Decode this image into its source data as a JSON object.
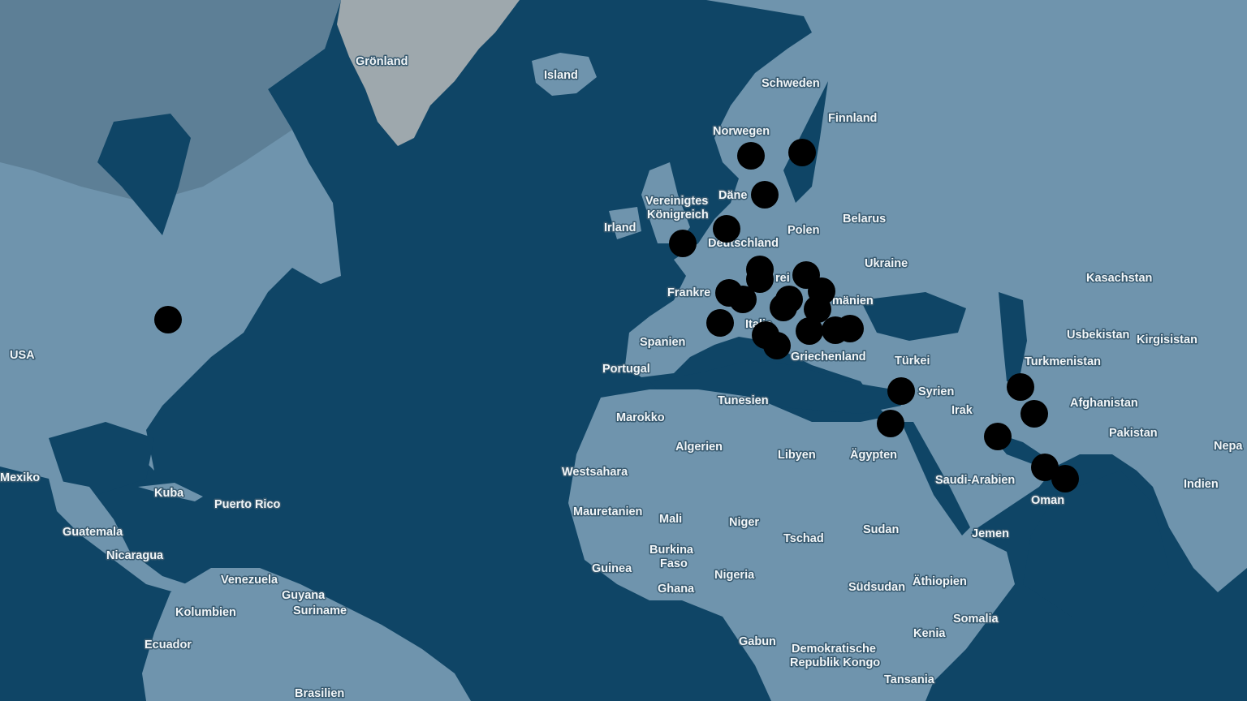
{
  "map": {
    "background_color": "#0f4566",
    "land_color": "#6f94ad",
    "land_shade_color": "#5d7f96",
    "greenland_color": "#9ea8ad",
    "marker_icon": "store-icon",
    "labels": {
      "groenland": "Grönland",
      "island": "Island",
      "schweden": "Schweden",
      "finnland": "Finnland",
      "norwegen": "Norwegen",
      "vereinigtes": "Vereinigtes",
      "koenigreich": "Königreich",
      "daenemark": "Däne",
      "irland": "Irland",
      "polen": "Polen",
      "belarus": "Belarus",
      "deutschland": "Deutschland",
      "ukraine": "Ukraine",
      "kasachstan": "Kasachstan",
      "frankreich": "Frankre",
      "oesterreich": "rei",
      "rumaenien": "mänien",
      "usbekistan": "Usbekistan",
      "kirgisistan": "Kirgisistan",
      "spanien": "Spanien",
      "italien": "Italie",
      "griechenland": "Griechenland",
      "tuerkei": "Türkei",
      "turkmenistan": "Turkmenistan",
      "usa": "USA",
      "portugal": "Portugal",
      "syrien": "Syrien",
      "irak": "Irak",
      "afghanistan": "Afghanistan",
      "tunesien": "Tunesien",
      "marokko": "Marokko",
      "pakistan": "Pakistan",
      "algerien": "Algerien",
      "libyen": "Libyen",
      "aegypten": "Ägypten",
      "nepal": "Nepa",
      "westsahara": "Westsahara",
      "mexiko": "Mexiko",
      "saudi_arabien": "Saudi-Arabien",
      "indien": "Indien",
      "kuba": "Kuba",
      "puerto_rico": "Puerto Rico",
      "oman": "Oman",
      "mauretanien": "Mauretanien",
      "mali": "Mali",
      "niger": "Niger",
      "guatemala": "Guatemala",
      "tschad": "Tschad",
      "sudan": "Sudan",
      "jemen": "Jemen",
      "burkina": "Burkina",
      "faso": "Faso",
      "nicaragua": "Nicaragua",
      "guinea": "Guinea",
      "nigeria": "Nigeria",
      "venezuela": "Venezuela",
      "ghana": "Ghana",
      "suedsudan": "Südsudan",
      "aethiopien": "Äthiopien",
      "guyana": "Guyana",
      "kolumbien": "Kolumbien",
      "suriname": "Suriname",
      "somalia": "Somalia",
      "kenia": "Kenia",
      "ecuador": "Ecuador",
      "gabun": "Gabun",
      "demokratische": "Demokratische",
      "republik_kongo": "Republik Kongo",
      "tansania": "Tansania",
      "brasilien": "Brasilien"
    }
  }
}
